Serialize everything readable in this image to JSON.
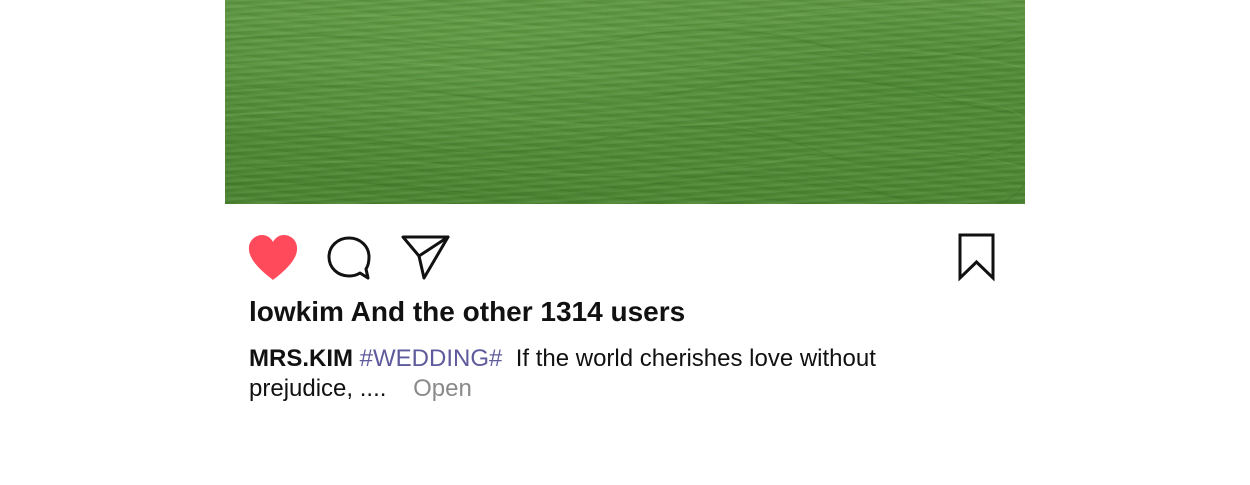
{
  "post": {
    "image_description_icon": "grass-photo",
    "actions": {
      "like_icon": "heart-icon",
      "comment_icon": "comment-bubble-icon",
      "share_icon": "paper-plane-icon",
      "save_icon": "bookmark-icon",
      "like_color": "#ff4a5c"
    },
    "likes_text": "lowkim And the other 1314 users",
    "caption": {
      "username": "MRS.KIM",
      "hashtag": "#WEDDING#",
      "text": "If the world cherishes love without prejudice, ....",
      "more_label": "Open"
    }
  }
}
